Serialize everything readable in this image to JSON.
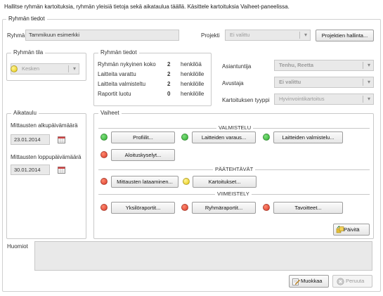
{
  "intro": "Hallitse ryhmän kartoituksia, ryhmän yleisiä tietoja sekä aikataulua täällä. Käsittele kartoituksia Vaiheet-paneelissa.",
  "group_info": {
    "title": "Ryhmän tiedot",
    "group_label": "Ryhmä",
    "group_value": "Tammikuun esimerkki",
    "project_label": "Projekti",
    "project_value": "Ei valittu",
    "manage_projects": "Projektien hallinta..."
  },
  "status": {
    "title": "Ryhmän tila",
    "value": "Kesken",
    "color": "#e8c90a"
  },
  "stats": {
    "title": "Ryhmän tiedot",
    "rows": [
      {
        "label": "Ryhmän nykyinen koko",
        "count": "2",
        "unit": "henkilöä"
      },
      {
        "label": "Laitteita varattu",
        "count": "2",
        "unit": "henkilölle"
      },
      {
        "label": "Laitteita valmisteltu",
        "count": "2",
        "unit": "henkilölle"
      },
      {
        "label": "Raportit luotu",
        "count": "0",
        "unit": "henkilölle"
      }
    ]
  },
  "right_fields": {
    "expert_label": "Asiantuntija",
    "expert_value": "Tenhu, Reetta",
    "guardian_label": "Avustaja",
    "guardian_value": "Ei valittu",
    "type_label": "Kartoituksen tyyppi",
    "type_value": "Hyvinvointikartoitus"
  },
  "schedule": {
    "title": "Aikataulu",
    "start_label": "Mittausten alkupäivämäärä",
    "start_value": "23.01.2014",
    "end_label": "Mittausten loppupäivämäärä",
    "end_value": "30.01.2014"
  },
  "phases": {
    "title": "Vaiheet",
    "valmistelu": "VALMISTELU",
    "profiilit": "Profiilit...",
    "laitteiden_varaus": "Laitteiden varaus...",
    "laitteiden_valmistelu": "Laitteiden valmistelu...",
    "aloituskyselyt": "Aloituskyselyt...",
    "paatehtavat": "PÄÄTEHTÄVÄT",
    "mittausten_lataaminen": "Mittausten lataaminen...",
    "kartoitukset": "Kartoitukset...",
    "viimeistely": "VIIMEISTELY",
    "yksiloraportit": "Yksilöraportit...",
    "ryhmaraportit": "Ryhmäraportit...",
    "tavoitteet": "Tavoitteet...",
    "refresh": "Päivitä"
  },
  "notes": {
    "label": "Huomiot"
  },
  "footer": {
    "edit": "Muokkaa",
    "cancel": "Peruuta"
  }
}
